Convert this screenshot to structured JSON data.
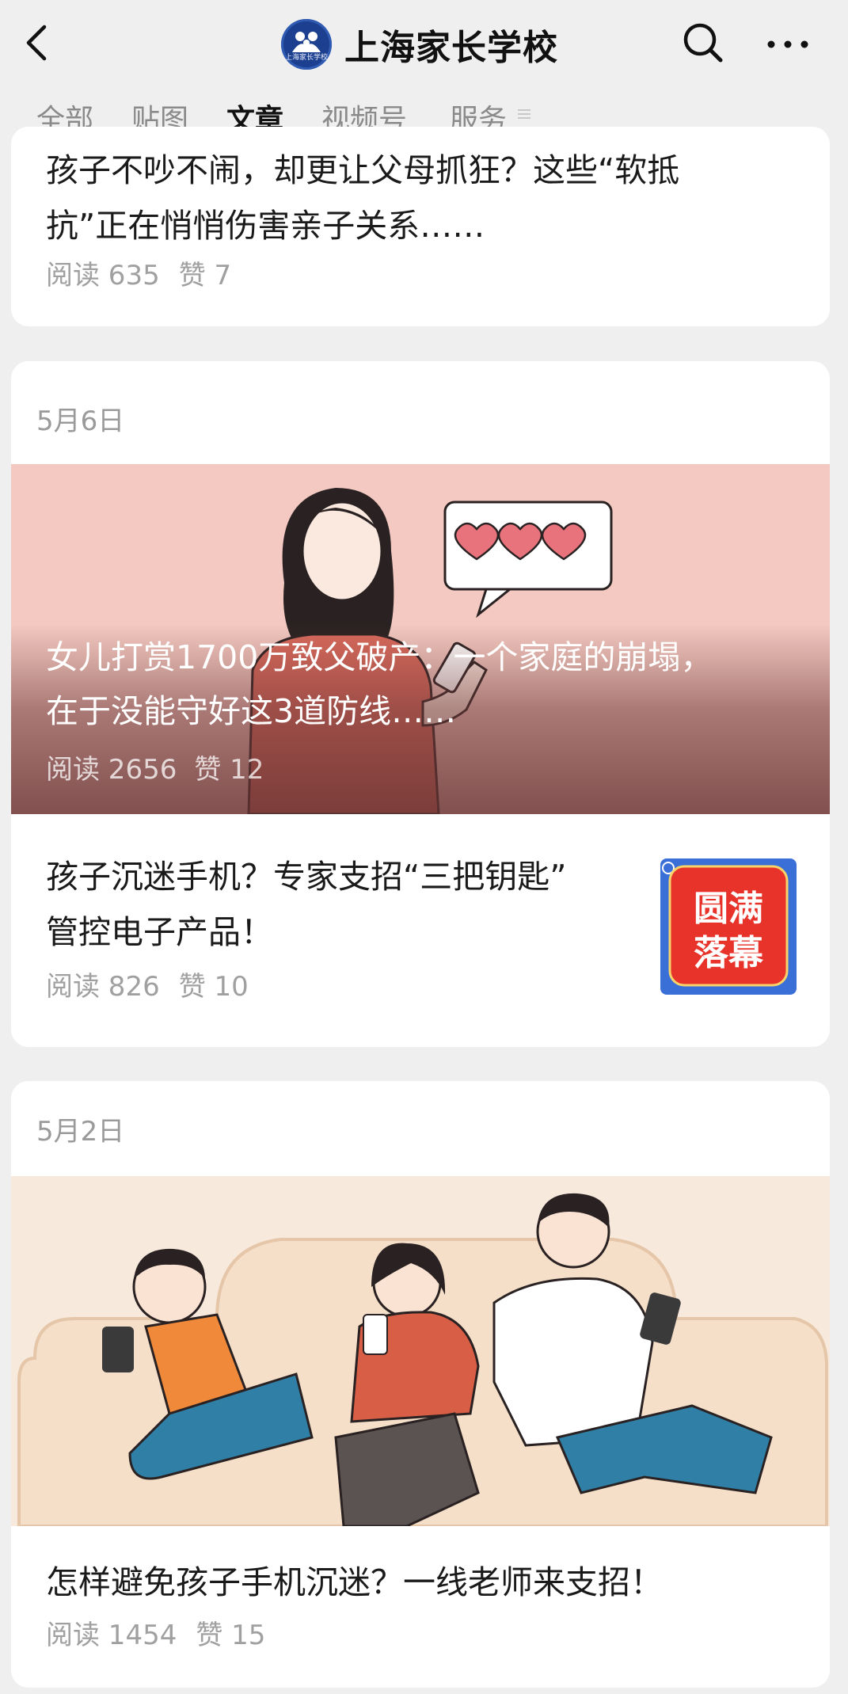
{
  "header": {
    "account_name": "上海家长学校",
    "logo_text": "上海家长学校",
    "icons": {
      "back": "back-arrow-icon",
      "search": "search-icon",
      "more": "more-dots-icon"
    }
  },
  "tabs": [
    {
      "label": "全部",
      "active": false
    },
    {
      "label": "贴图",
      "active": false
    },
    {
      "label": "文章",
      "active": true
    },
    {
      "label": "视频号",
      "active": false
    },
    {
      "label": "服务",
      "active": false
    }
  ],
  "cards": [
    {
      "articles": [
        {
          "title_line1": "孩子不吵不闹，却更让父母抓狂？这些“软抵",
          "title_line2": "抗”正在悄悄伤害亲子关系……",
          "reads": "阅读 635",
          "likes": "赞 7"
        }
      ]
    },
    {
      "date": "5月6日",
      "hero": {
        "title_line1": "女儿打赏1700万致父破产：一个家庭的崩塌，",
        "title_line2": "在于没能守好这3道防线……",
        "reads": "阅读 2656",
        "likes": "赞 12"
      },
      "articles": [
        {
          "title_line1": "孩子沉迷手机？专家支招“三把钥匙”",
          "title_line2": "管控电子产品！",
          "reads": "阅读 826",
          "likes": "赞 10",
          "thumb_text_1": "圆满",
          "thumb_text_2": "落幕"
        }
      ]
    },
    {
      "date": "5月2日",
      "articles": [
        {
          "title_line1": "怎样避免孩子手机沉迷？一线老师来支招！",
          "reads": "阅读 1454",
          "likes": "赞 15"
        }
      ]
    }
  ],
  "colors": {
    "page_bg": "#efefef",
    "card_bg": "#ffffff",
    "hero1_bg": "#f3c9c1",
    "hero2_bg": "#f7e9dc",
    "thumb_red": "#e8332a",
    "thumb_blue": "#3b6fd8"
  }
}
